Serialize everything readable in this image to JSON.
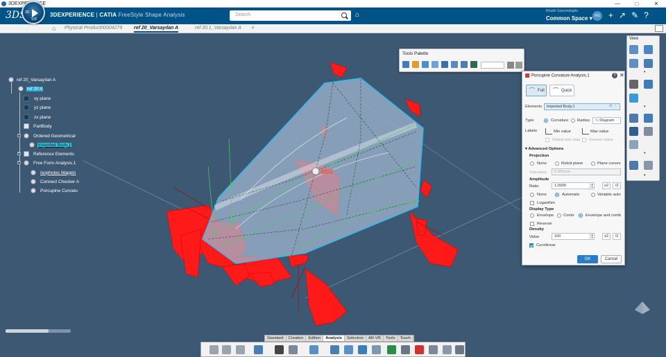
{
  "window": {
    "title": "3DEXPERIENCE",
    "controls": [
      "—",
      "□",
      "✕"
    ]
  },
  "header": {
    "brand_prefix": "3DEXPERIENCE",
    "brand_sep": " | ",
    "brand_product": "CATIA",
    "brand_app": " FreeStyle Shape Analysis",
    "compass_3d": "3D",
    "compass_v": "V,R",
    "search_placeholder": "Search",
    "user_name": "Rkadir Gunumdogdu",
    "space_name": "Common Space",
    "avatar_initials": "RG",
    "icons": [
      "add-icon",
      "share-icon",
      "tools-icon",
      "help-icon"
    ]
  },
  "tabs": {
    "items": [
      {
        "label": "Physical Product00004279",
        "active": false
      },
      {
        "label": "ref 20_Varsayılan A",
        "active": true
      },
      {
        "label": "ref 20.1_Varsayılan A",
        "active": false
      }
    ],
    "add_label": "+"
  },
  "tree": {
    "root": "ref 20_Varsayılan A",
    "items": [
      {
        "label": "ref 20 A",
        "highlight": "selected"
      },
      {
        "label": "xy plane"
      },
      {
        "label": "yz plane"
      },
      {
        "label": "zx plane"
      },
      {
        "label": "PartBody"
      },
      {
        "label": "Ordered Geometrical"
      },
      {
        "label": "Imported Body.1",
        "highlight": "active"
      },
      {
        "label": "Reference Elements"
      },
      {
        "label": "Free Form Analysis.1"
      },
      {
        "label": "Isophotes Mappin"
      },
      {
        "label": "Connect Checker A"
      },
      {
        "label": "Porcupine Curvatu"
      }
    ]
  },
  "tools_palette": {
    "title": "Tools Palette"
  },
  "dialog": {
    "title": "Porcupine Curvature Analysis.1",
    "help": "?",
    "close": "✕",
    "mode_full": "Full",
    "mode_quick": "Quick",
    "elements_label": "Elements",
    "elements_value": "Imported Body.1",
    "type_label": "Type",
    "type_curvature": "Curvature",
    "type_radius": "Radius",
    "diagram_label": "Diagram",
    "labels_label": "Labels",
    "min_value": "Min value",
    "max_value": "Max value",
    "global_min_max": "Global min max",
    "inverse_value": "Inverse value",
    "advanced_options": "Advanced Options",
    "projection": "Projection",
    "proj_none": "None",
    "proj_robot": "Robot plane",
    "proj_plane_curves": "Plane curves",
    "tolerance_label": "Tolerance",
    "tolerance_value": "0.001mm",
    "amplitude": "Amplitude",
    "ratio_label": "Ratio",
    "ratio_value": "1.0000",
    "x2": "x2",
    "div2": "/2",
    "amp_none": "None",
    "amp_auto": "Automatic",
    "amp_variable": "Variable auto",
    "logarithm": "Logarithm",
    "display_type": "Display Type",
    "disp_envelope": "Envelope",
    "disp_comb": "Comb",
    "disp_env_comb": "Envelope and comb",
    "reverse": "Reverse",
    "density": "Density",
    "density_label": "Value",
    "density_value": "100",
    "curvilinear": "Curvilinear",
    "ok": "OK",
    "cancel": "Cancel"
  },
  "right_bar": {
    "title": "View"
  },
  "bottom_tabs": {
    "items": [
      {
        "label": "Standard",
        "active": false
      },
      {
        "label": "Creation",
        "active": false
      },
      {
        "label": "Edition",
        "active": false
      },
      {
        "label": "Analysis",
        "active": true
      },
      {
        "label": "Selection",
        "active": false
      },
      {
        "label": "AR-VR",
        "active": false
      },
      {
        "label": "Tools",
        "active": false
      },
      {
        "label": "Touch",
        "active": false
      }
    ]
  },
  "colors": {
    "background": "#3d5873",
    "header": "#005386",
    "porcupine": "#ff1a1a",
    "surface_edge": "#35b9ea",
    "ok_button": "#2b7cc4"
  }
}
